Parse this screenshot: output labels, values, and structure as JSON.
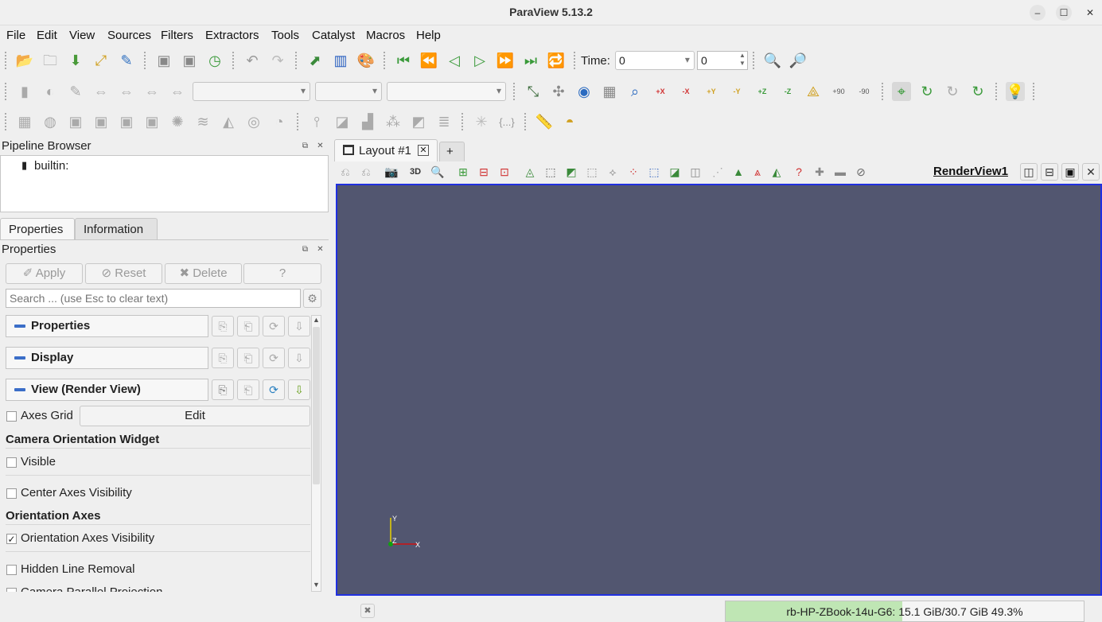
{
  "window": {
    "title": "ParaView 5.13.2"
  },
  "menu": [
    "File",
    "Edit",
    "View",
    "Sources",
    "Filters",
    "Extractors",
    "Tools",
    "Catalyst",
    "Macros",
    "Help"
  ],
  "time": {
    "label": "Time:",
    "value": "0",
    "step": "0"
  },
  "view_buttons": {
    "plus_x": "+X",
    "minus_x": "-X",
    "plus_y": "+Y",
    "minus_y": "-Y",
    "plus_z": "+Z",
    "minus_z": "-Z",
    "rot_plus90": "+90",
    "rot_minus90": "-90",
    "curly": "{...}"
  },
  "pipeline": {
    "title": "Pipeline Browser",
    "root": "builtin:"
  },
  "tabs": {
    "properties": "Properties",
    "information": "Information"
  },
  "properties": {
    "title": "Properties",
    "apply": "Apply",
    "reset": "Reset",
    "delete": "Delete",
    "help": "?",
    "search_placeholder": "Search ... (use Esc to clear text)",
    "sections": [
      "Properties",
      "Display",
      "View (Render View)"
    ],
    "axes_grid": {
      "label": "Axes Grid",
      "checked": false,
      "button": "Edit"
    },
    "camera_group": "Camera Orientation Widget",
    "visible": {
      "label": "Visible",
      "checked": false
    },
    "center_axes": {
      "label": "Center Axes Visibility",
      "checked": false
    },
    "orientation_group": "Orientation Axes",
    "orientation_vis": {
      "label": "Orientation Axes Visibility",
      "checked": true
    },
    "hidden_line": {
      "label": "Hidden Line Removal",
      "checked": false
    },
    "camera_parallel": {
      "label": "Camera Parallel Projection",
      "checked": false
    }
  },
  "layout": {
    "tab_label": "Layout #1",
    "add_tab": "+",
    "view_name": "RenderView1",
    "three_d": "3D"
  },
  "render": {
    "background": "#525670",
    "axis_x": "X",
    "axis_y": "Y",
    "axis_z": "Z"
  },
  "status": {
    "memory_text": "rb-HP-ZBook-14u-G6: 15.1 GiB/30.7 GiB 49.3%",
    "memory_fraction": 0.493
  }
}
